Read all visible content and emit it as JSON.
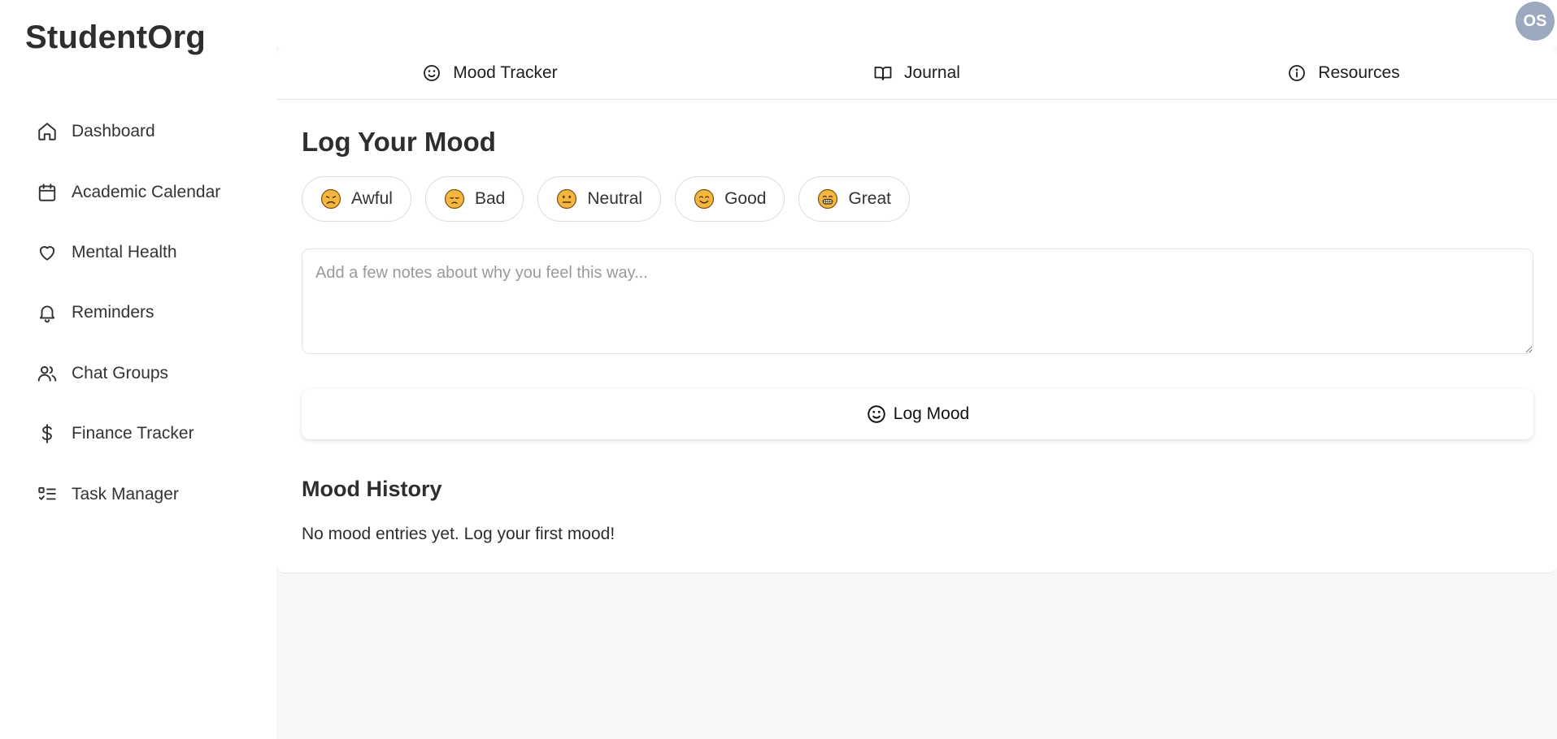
{
  "app": {
    "brand": "StudentOrg",
    "avatar_initials": "OS"
  },
  "sidebar": {
    "items": [
      {
        "label": "Dashboard",
        "icon": "home-icon"
      },
      {
        "label": "Academic Calendar",
        "icon": "calendar-icon"
      },
      {
        "label": "Mental Health",
        "icon": "heart-icon"
      },
      {
        "label": "Reminders",
        "icon": "bell-icon"
      },
      {
        "label": "Chat Groups",
        "icon": "users-icon"
      },
      {
        "label": "Finance Tracker",
        "icon": "dollar-icon"
      },
      {
        "label": "Task Manager",
        "icon": "list-checks-icon"
      }
    ]
  },
  "tabs": [
    {
      "label": "Mood Tracker",
      "icon": "smile-icon"
    },
    {
      "label": "Journal",
      "icon": "book-open-icon"
    },
    {
      "label": "Resources",
      "icon": "info-icon"
    }
  ],
  "mood": {
    "title": "Log Your Mood",
    "options": [
      {
        "label": "Awful",
        "icon": "awful-emoji-icon"
      },
      {
        "label": "Bad",
        "icon": "bad-emoji-icon"
      },
      {
        "label": "Neutral",
        "icon": "neutral-emoji-icon"
      },
      {
        "label": "Good",
        "icon": "good-emoji-icon"
      },
      {
        "label": "Great",
        "icon": "great-emoji-icon"
      }
    ],
    "notes_value": "",
    "notes_placeholder": "Add a few notes about why you feel this way...",
    "log_button_label": "Log Mood"
  },
  "history": {
    "title": "Mood History",
    "empty_message": "No mood entries yet. Log your first mood!"
  },
  "colors": {
    "avatar_bg": "#9aa9bd",
    "emoji_fill": "#f4b63e",
    "main_bg": "#f7f7f7",
    "text": "#2e2e2e"
  }
}
